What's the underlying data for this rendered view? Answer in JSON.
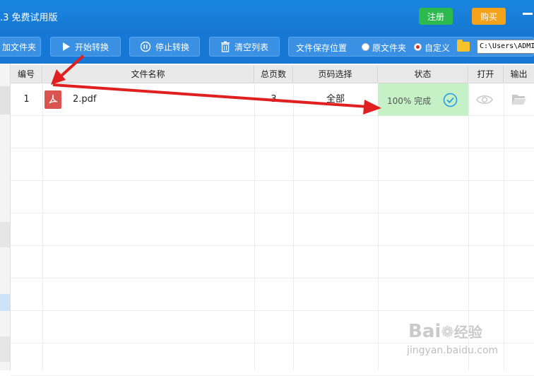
{
  "titlebar": {
    "title": ".3 免费试用版",
    "register_label": "注册",
    "buy_label": "购买"
  },
  "toolbar": {
    "add_folder_label": "加文件夹",
    "start_label": "开始转换",
    "stop_label": "停止转换",
    "clear_label": "清空列表",
    "save_location_label": "文件保存位置",
    "original_folder_label": "原文件夹",
    "custom_label": "自定义",
    "path_value": "C:\\Users\\ADMI"
  },
  "table": {
    "headers": [
      "编号",
      "文件名称",
      "总页数",
      "页码选择",
      "状态",
      "打开",
      "输出"
    ],
    "rows": [
      {
        "index": "1",
        "filename": "2.pdf",
        "pages": "3",
        "page_range": "全部",
        "status": "100% 完成"
      }
    ]
  },
  "watermark": {
    "brand": "Bai",
    "brand_suffix": "经验",
    "url": "jingyan.baidu.com"
  },
  "colors": {
    "titlebar": "#1577d2",
    "register": "#2cb94e",
    "buy": "#f3a21a",
    "status_done": "#c6f0c6",
    "annotation_arrow": "#e02020"
  },
  "icons": [
    "play-icon",
    "pause-icon",
    "trash-icon",
    "folder-icon",
    "pdf-icon",
    "check-circle-icon",
    "eye-icon",
    "open-folder-icon"
  ]
}
